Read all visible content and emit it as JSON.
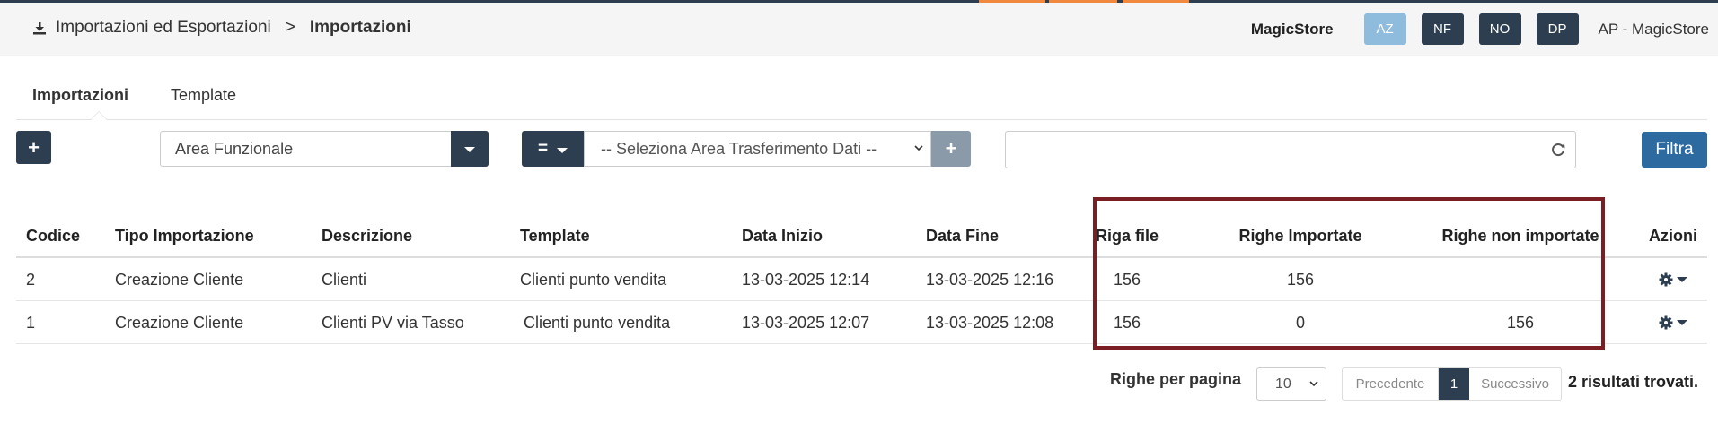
{
  "breadcrumb": {
    "icon": "download-icon",
    "parent": "Importazioni ed Esportazioni",
    "separator": ">",
    "current": "Importazioni"
  },
  "header": {
    "store": "MagicStore",
    "tags": [
      "AZ",
      "NF",
      "NO",
      "DP"
    ],
    "user": "AP - MagicStore"
  },
  "tabs": [
    {
      "label": "Importazioni",
      "active": true
    },
    {
      "label": "Template",
      "active": false
    }
  ],
  "filters": {
    "add_icon": "plus-icon",
    "area_select": "Area Funzionale",
    "operator": "=",
    "transfer_select": "-- Seleziona Area Trasferimento Dati --",
    "search_value": "",
    "filter_button": "Filtra"
  },
  "table": {
    "headers": [
      "Codice",
      "Tipo Importazione",
      "Descrizione",
      "Template",
      "Data Inizio",
      "Data Fine",
      "Riga file",
      "Righe Importate",
      "Righe non importate",
      "Azioni"
    ],
    "rows": [
      [
        "2",
        "Creazione Cliente",
        "Clienti",
        "Clienti punto vendita",
        "13-03-2025 12:14",
        "13-03-2025 12:16",
        "156",
        "156",
        ""
      ],
      [
        "1",
        "Creazione Cliente",
        "Clienti PV via Tasso",
        "Clienti punto vendita",
        "13-03-2025 12:07",
        "13-03-2025 12:08",
        "156",
        "0",
        "156"
      ]
    ]
  },
  "pagination": {
    "rows_per_page_label": "Righe per pagina",
    "rows_per_page": "10",
    "prev": "Precedente",
    "current_page": "1",
    "next": "Successivo",
    "results": "2 risultati trovati."
  },
  "colors": {
    "dark": "#2c3e50",
    "accent_orange": "#f0883e",
    "filter_blue": "#2c6aa0",
    "highlight": "#7b1e23"
  }
}
